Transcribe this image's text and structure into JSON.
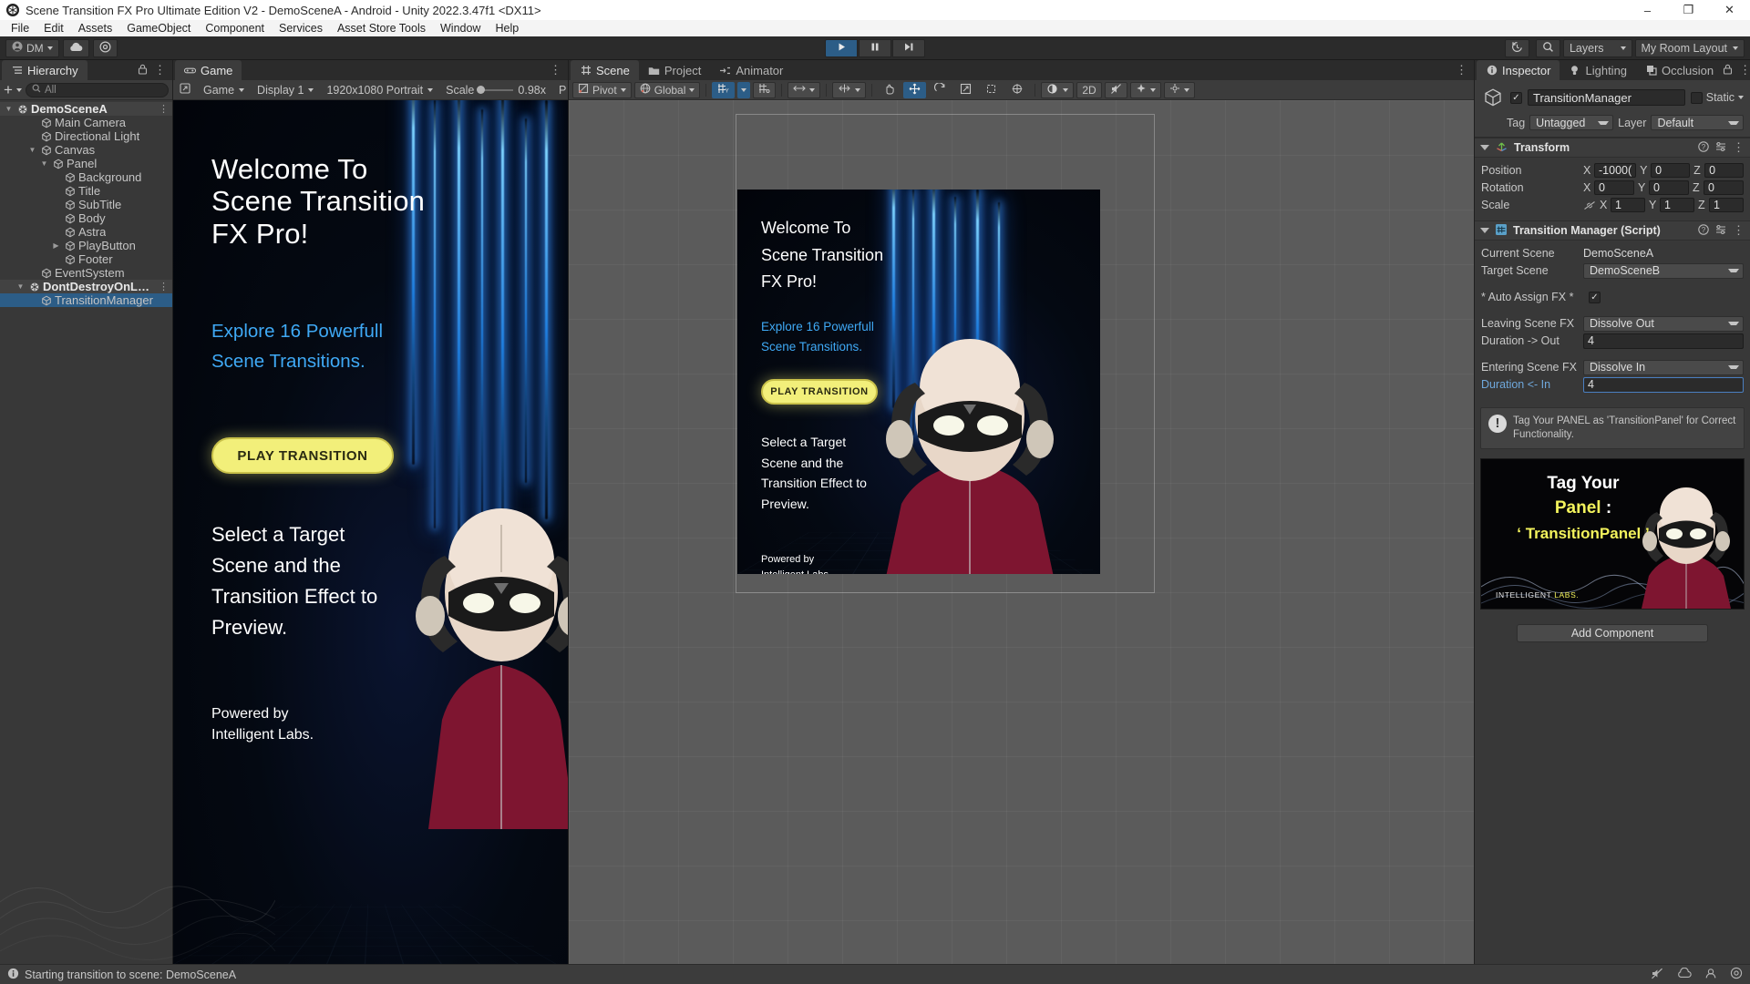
{
  "window": {
    "title": "Scene Transition FX Pro Ultimate Edition V2 - DemoSceneA - Android - Unity 2022.3.47f1 <DX11>",
    "app_icon": "unity-icon",
    "minimize": "–",
    "maximize": "❐",
    "close": "✕"
  },
  "menubar": {
    "items": [
      "File",
      "Edit",
      "Assets",
      "GameObject",
      "Component",
      "Services",
      "Asset Store Tools",
      "Window",
      "Help"
    ]
  },
  "toolbar": {
    "account_label": "DM",
    "cloud_icon": "cloud-icon",
    "settings_icon": "gear-icon",
    "play_icon": "play-icon",
    "pause_icon": "pause-icon",
    "step_icon": "step-icon",
    "history_icon": "history-icon",
    "search_icon": "search-icon",
    "layers_label": "Layers",
    "layout_label": "My Room Layout"
  },
  "hierarchy": {
    "tab_label": "Hierarchy",
    "tab_icon": "hierarchy-icon",
    "lock_icon": "lock-icon",
    "kebab": "⋮",
    "add_label": "+",
    "search_placeholder": "All",
    "search_icon": "search-icon",
    "rows": [
      {
        "label": "DemoSceneA",
        "indent": 0,
        "arrow": "down",
        "icon": "unity-scene-icon",
        "kebab": true,
        "selected": false,
        "scene": true
      },
      {
        "label": "Main Camera",
        "indent": 2,
        "arrow": "",
        "icon": "gameobject-icon",
        "kebab": false,
        "selected": false
      },
      {
        "label": "Directional Light",
        "indent": 2,
        "arrow": "",
        "icon": "gameobject-icon",
        "kebab": false,
        "selected": false
      },
      {
        "label": "Canvas",
        "indent": 2,
        "arrow": "down",
        "icon": "gameobject-icon",
        "kebab": false,
        "selected": false
      },
      {
        "label": "Panel",
        "indent": 3,
        "arrow": "down",
        "icon": "gameobject-icon",
        "kebab": false,
        "selected": false
      },
      {
        "label": "Background",
        "indent": 4,
        "arrow": "",
        "icon": "gameobject-icon",
        "kebab": false,
        "selected": false
      },
      {
        "label": "Title",
        "indent": 4,
        "arrow": "",
        "icon": "gameobject-icon",
        "kebab": false,
        "selected": false
      },
      {
        "label": "SubTitle",
        "indent": 4,
        "arrow": "",
        "icon": "gameobject-icon",
        "kebab": false,
        "selected": false
      },
      {
        "label": "Body",
        "indent": 4,
        "arrow": "",
        "icon": "gameobject-icon",
        "kebab": false,
        "selected": false
      },
      {
        "label": "Astra",
        "indent": 4,
        "arrow": "",
        "icon": "gameobject-icon",
        "kebab": false,
        "selected": false
      },
      {
        "label": "PlayButton",
        "indent": 4,
        "arrow": "right",
        "icon": "gameobject-icon",
        "kebab": false,
        "selected": false
      },
      {
        "label": "Footer",
        "indent": 4,
        "arrow": "",
        "icon": "gameobject-icon",
        "kebab": false,
        "selected": false
      },
      {
        "label": "EventSystem",
        "indent": 2,
        "arrow": "",
        "icon": "gameobject-icon",
        "kebab": false,
        "selected": false
      },
      {
        "label": "DontDestroyOnLoad",
        "indent": 1,
        "arrow": "down",
        "icon": "unity-scene-icon",
        "kebab": true,
        "selected": false,
        "scene": true
      },
      {
        "label": "TransitionManager",
        "indent": 2,
        "arrow": "",
        "icon": "gameobject-icon",
        "kebab": false,
        "selected": true
      }
    ]
  },
  "game_panel": {
    "tab_label": "Game",
    "tab_icon": "gamepad-icon",
    "kebab": "⋮",
    "maximize_icon": "maximize-icon",
    "toolbar": {
      "target": "Game",
      "display": "Display 1",
      "resolution": "1920x1080 Portrait",
      "scale_label": "Scale",
      "scale_value": "0.98x",
      "play_focused": "P"
    },
    "content": {
      "title": "Welcome To\nScene Transition\nFX Pro!",
      "title_lines": [
        "Welcome To",
        "Scene Transition",
        "FX Pro!"
      ],
      "subtitle_lines": [
        "Explore 16 Powerfull",
        "Scene Transitions."
      ],
      "button_label": "PLAY TRANSITION",
      "body_lines": [
        "Select a Target",
        "Scene and the",
        "Transition Effect to",
        "Preview."
      ],
      "footer_lines": [
        "Powered by",
        "Intelligent Labs."
      ]
    }
  },
  "scene_panel": {
    "tabs": [
      {
        "label": "Scene",
        "icon": "grid-icon",
        "active": true
      },
      {
        "label": "Project",
        "icon": "folder-icon",
        "active": false
      },
      {
        "label": "Animator",
        "icon": "animator-icon",
        "active": false
      }
    ],
    "kebab": "⋮",
    "toolbar": {
      "pivot": "Pivot",
      "global": "Global",
      "twod": "2D",
      "hand_icon": "hand-tool-icon",
      "move_icon": "move-tool-icon",
      "rotate_icon": "rotate-tool-icon",
      "scale_icon": "scale-tool-icon",
      "rect_icon": "rect-tool-icon",
      "transform_icon": "transform-tool-icon",
      "grid_icon": "grid-snap-icon",
      "layout_icon": "layout-icon",
      "lighting_icon": "lighting-toggle-icon",
      "audio_icon": "audio-mute-icon",
      "fx_icon": "fx-icon",
      "gizmos_icon": "gizmos-icon"
    },
    "preview": {
      "title_lines": [
        "Welcome To",
        "Scene Transition",
        "FX Pro!"
      ],
      "subtitle_lines": [
        "Explore 16 Powerfull",
        "Scene Transitions."
      ],
      "button_label": "PLAY TRANSITION",
      "body_lines": [
        "Select a Target",
        "Scene and the",
        "Transition Effect to",
        "Preview."
      ],
      "footer_lines": [
        "Powered by",
        "Intelligent Labs."
      ]
    }
  },
  "inspector": {
    "tabs": [
      {
        "label": "Inspector",
        "icon": "info-icon",
        "active": true
      },
      {
        "label": "Lighting",
        "icon": "light-icon",
        "active": false
      },
      {
        "label": "Occlusion",
        "icon": "occlusion-icon",
        "active": false
      }
    ],
    "lock_icon": "lock-icon",
    "kebab": "⋮",
    "object": {
      "enabled": true,
      "name": "TransitionManager",
      "static_label": "Static",
      "static_checked": false,
      "tag_label": "Tag",
      "tag_value": "Untagged",
      "layer_label": "Layer",
      "layer_value": "Default"
    },
    "transform": {
      "title": "Transform",
      "icon": "transform-icon",
      "help_icon": "help-icon",
      "preset_icon": "preset-icon",
      "kebab": "⋮",
      "rows": [
        {
          "label": "Position",
          "x": "-1000(",
          "y": "0",
          "z": "0"
        },
        {
          "label": "Rotation",
          "x": "0",
          "y": "0",
          "z": "0"
        },
        {
          "label": "Scale",
          "x": "1",
          "y": "1",
          "z": "1",
          "link_icon": "constrain-off-icon"
        }
      ]
    },
    "script": {
      "title": "Transition Manager (Script)",
      "icon": "script-icon",
      "help_icon": "help-icon",
      "preset_icon": "preset-icon",
      "kebab": "⋮",
      "fields": [
        {
          "label": "Current Scene",
          "type": "text",
          "value": "DemoSceneA"
        },
        {
          "label": "Target Scene",
          "type": "dropdown",
          "value": "DemoSceneB"
        },
        {
          "label": "* Auto Assign FX *",
          "type": "checkbox",
          "value": true
        },
        {
          "label": "Leaving Scene FX",
          "type": "dropdown",
          "value": "Dissolve Out"
        },
        {
          "label": "Duration -> Out",
          "type": "number",
          "value": "4"
        },
        {
          "label": "Entering Scene FX",
          "type": "dropdown",
          "value": "Dissolve In"
        },
        {
          "label": "Duration <- In",
          "type": "number",
          "value": "4",
          "highlight": true
        }
      ],
      "help_text": "Tag Your PANEL as 'TransitionPanel' for Correct Functionality.",
      "warning_icon": "warning-icon"
    },
    "promo": {
      "line1": "Tag Your",
      "line2a": "Panel",
      "line2b": " :",
      "line3": "‘ TransitionPanel ’",
      "brand_a": "INTELLIGENT ",
      "brand_b": "LABS."
    },
    "add_component_label": "Add Component"
  },
  "statusbar": {
    "icon": "info-icon",
    "message": "Starting transition to scene: DemoSceneA",
    "right_icons": [
      "audio-mute-icon",
      "cloud-status-icon",
      "collab-icon",
      "settings-icon"
    ]
  },
  "colors": {
    "accent_blue": "#2c5d87",
    "panel_bg": "#383838",
    "toolbar_bg": "#3c3c3c",
    "window_bg": "#2b2b2b",
    "link_blue": "#3fa9f5",
    "button_yellow": "#f2ef7a",
    "scene_bg": "#5b5b5b"
  }
}
